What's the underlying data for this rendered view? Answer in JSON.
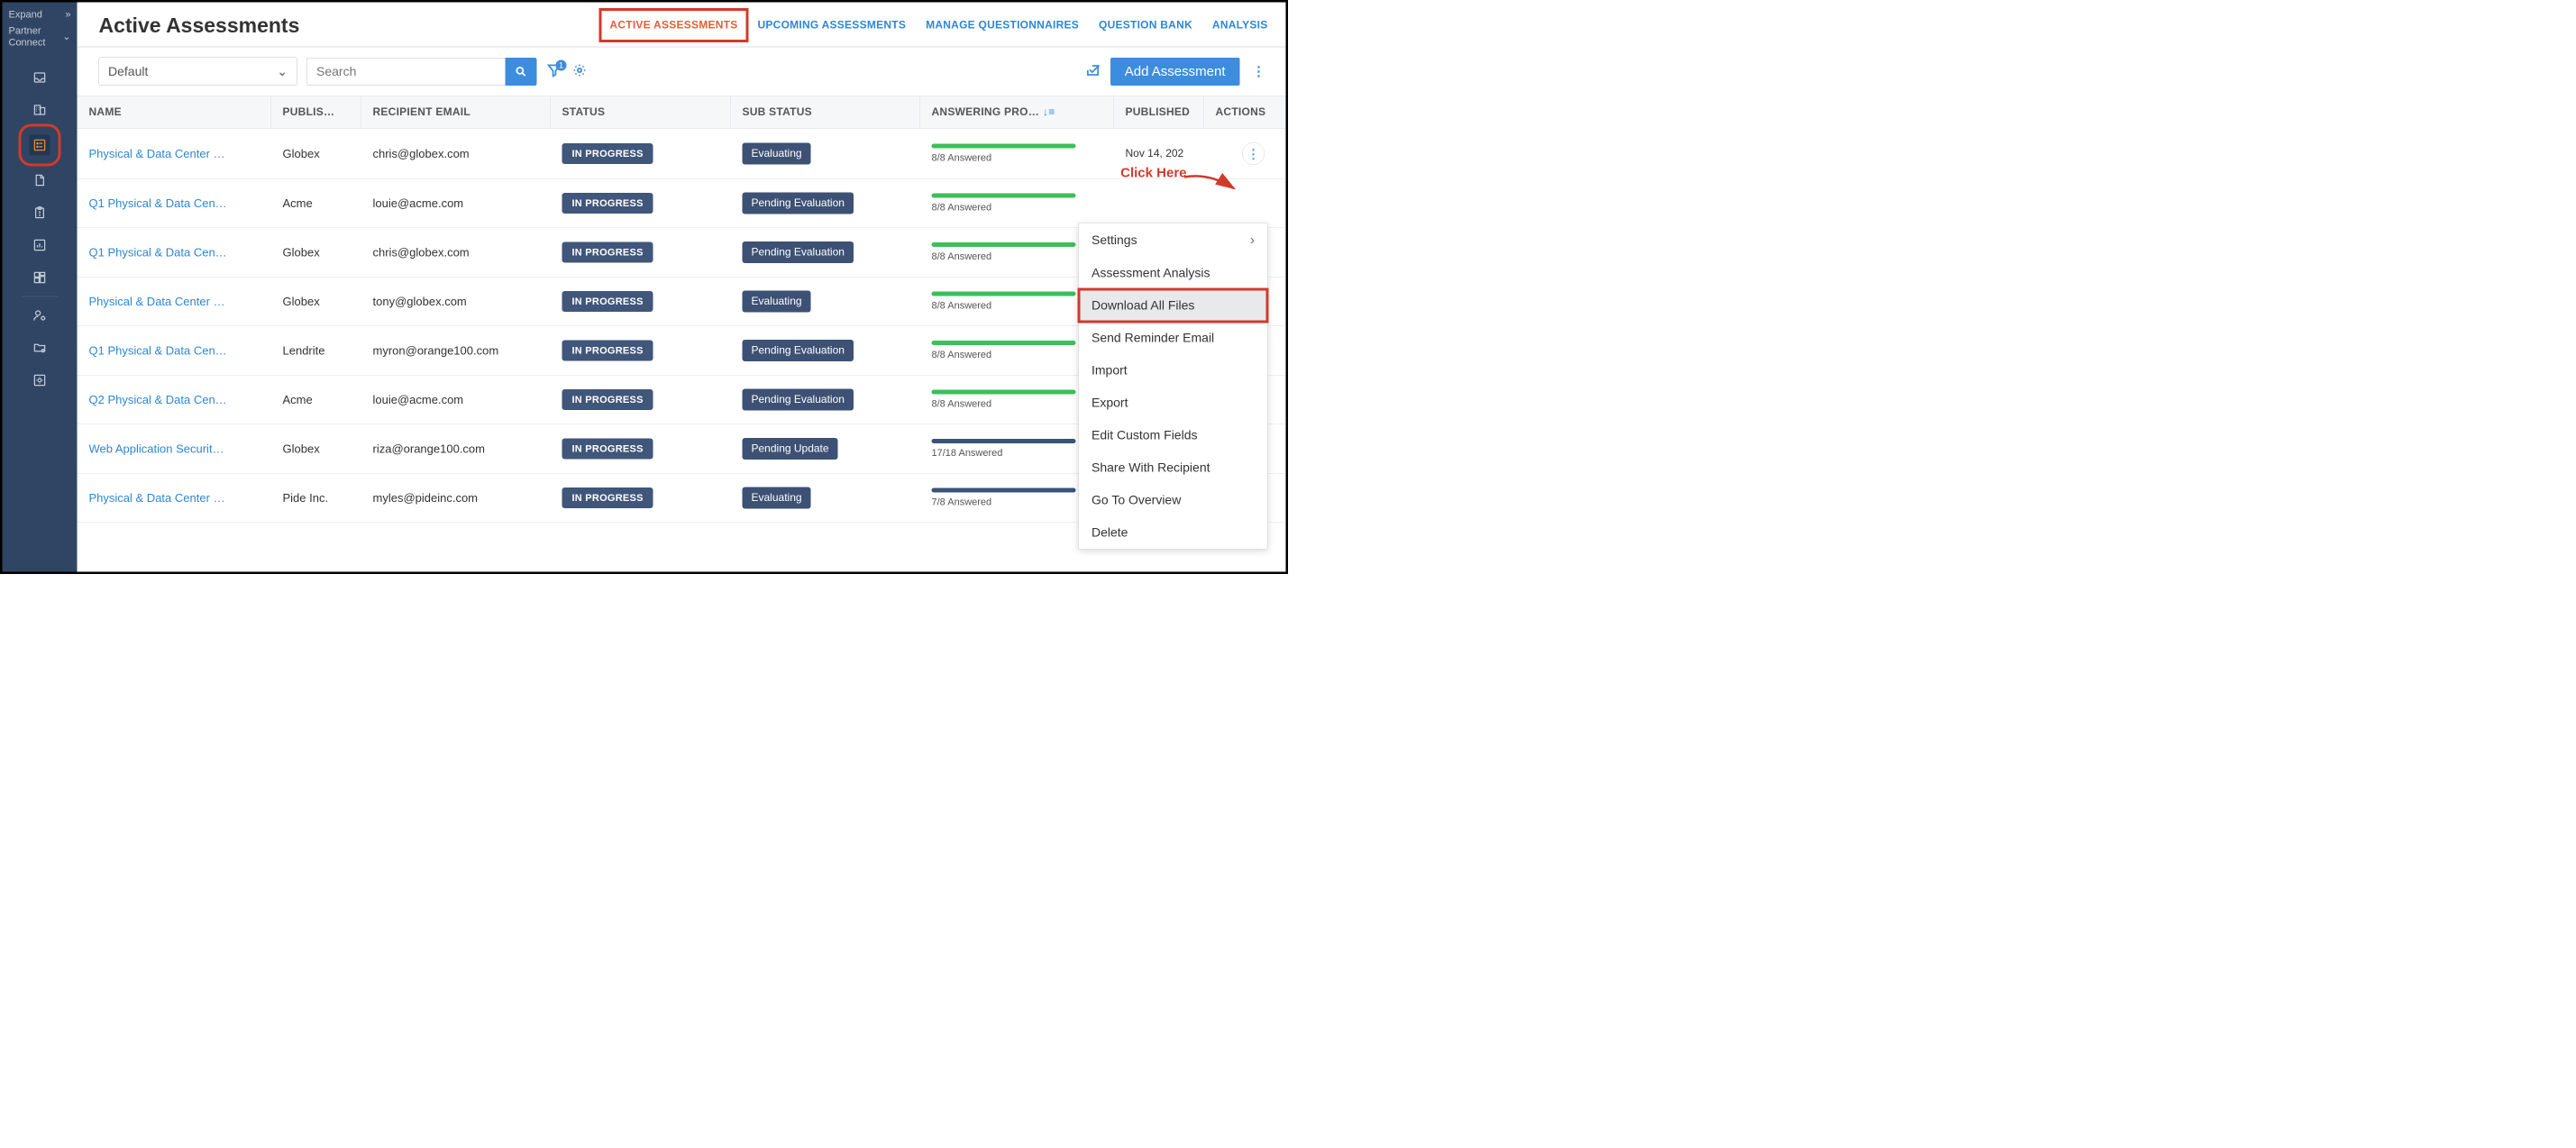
{
  "sidebar": {
    "expand": "Expand",
    "connect": "Partner Connect"
  },
  "header": {
    "title": "Active Assessments",
    "tabs": [
      "ACTIVE ASSESSMENTS",
      "UPCOMING ASSESSMENTS",
      "MANAGE QUESTIONNAIRES",
      "QUESTION BANK",
      "ANALYSIS"
    ]
  },
  "toolbar": {
    "view_selector": "Default",
    "search_placeholder": "Search",
    "filter_count": "1",
    "add_button": "Add Assessment"
  },
  "columns": {
    "name": "NAME",
    "publisher": "PUBLIS…",
    "email": "RECIPIENT EMAIL",
    "status": "STATUS",
    "substatus": "SUB STATUS",
    "progress": "ANSWERING PRO…",
    "published": "PUBLISHED",
    "actions": "ACTIONS"
  },
  "rows": [
    {
      "name": "Physical & Data Center …",
      "publisher": "Globex",
      "email": "chris@globex.com",
      "status": "IN PROGRESS",
      "substatus": "Evaluating",
      "progress": "8/8 Answered",
      "bar": "green",
      "date": "Nov 14, 202"
    },
    {
      "name": "Q1 Physical & Data Cen…",
      "publisher": "Acme",
      "email": "louie@acme.com",
      "status": "IN PROGRESS",
      "substatus": "Pending Evaluation",
      "progress": "8/8 Answered",
      "bar": "green",
      "date": ""
    },
    {
      "name": "Q1 Physical & Data Cen…",
      "publisher": "Globex",
      "email": "chris@globex.com",
      "status": "IN PROGRESS",
      "substatus": "Pending Evaluation",
      "progress": "8/8 Answered",
      "bar": "green",
      "date": ""
    },
    {
      "name": "Physical & Data Center …",
      "publisher": "Globex",
      "email": "tony@globex.com",
      "status": "IN PROGRESS",
      "substatus": "Evaluating",
      "progress": "8/8 Answered",
      "bar": "green",
      "date": ""
    },
    {
      "name": "Q1 Physical & Data Cen…",
      "publisher": "Lendrite",
      "email": "myron@orange100.com",
      "status": "IN PROGRESS",
      "substatus": "Pending Evaluation",
      "progress": "8/8 Answered",
      "bar": "green",
      "date": ""
    },
    {
      "name": "Q2 Physical & Data Cen…",
      "publisher": "Acme",
      "email": "louie@acme.com",
      "status": "IN PROGRESS",
      "substatus": "Pending Evaluation",
      "progress": "8/8 Answered",
      "bar": "green",
      "date": ""
    },
    {
      "name": "Web Application Securit…",
      "publisher": "Globex",
      "email": "riza@orange100.com",
      "status": "IN PROGRESS",
      "substatus": "Pending Update",
      "progress": "17/18 Answered",
      "bar": "dark",
      "date": ""
    },
    {
      "name": "Physical & Data Center …",
      "publisher": "Pide Inc.",
      "email": "myles@pideinc.com",
      "status": "IN PROGRESS",
      "substatus": "Evaluating",
      "progress": "7/8 Answered",
      "bar": "dark",
      "date": ""
    }
  ],
  "menu": [
    "Settings",
    "Assessment Analysis",
    "Download All Files",
    "Send Reminder Email",
    "Import",
    "Export",
    "Edit Custom Fields",
    "Share With Recipient",
    "Go To Overview",
    "Delete"
  ],
  "annotations": {
    "click_here": "Click Here"
  }
}
